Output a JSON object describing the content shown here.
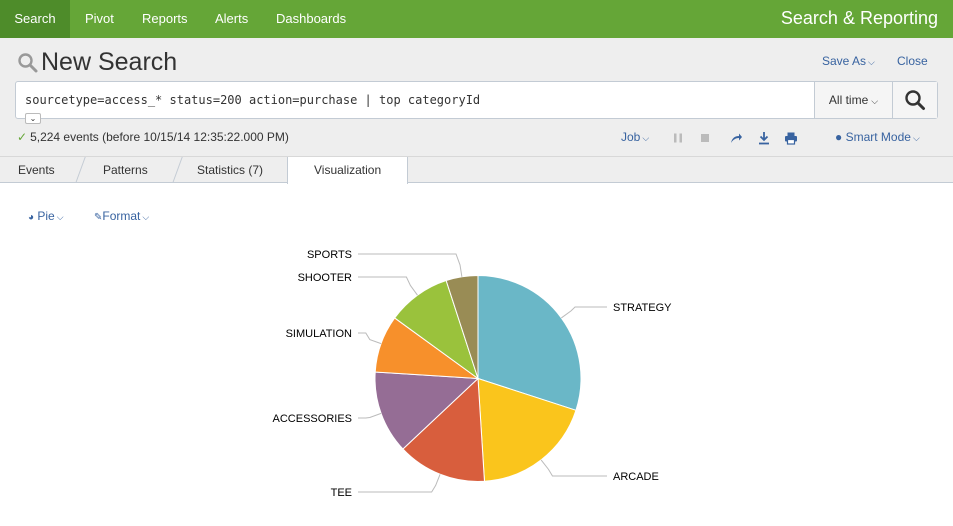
{
  "nav": {
    "items": [
      "Search",
      "Pivot",
      "Reports",
      "Alerts",
      "Dashboards"
    ],
    "active": "Search",
    "app_title": "Search & Reporting"
  },
  "header": {
    "page_title": "New Search",
    "save_as": "Save As",
    "close": "Close",
    "search_query": "sourcetype=access_* status=200 action=purchase | top categoryId",
    "time_range": "All time",
    "event_status": "5,224 events (before 10/15/14 12:35:22.000 PM)",
    "job_label": "Job",
    "mode_label": "Smart Mode"
  },
  "tabs": [
    "Events",
    "Patterns",
    "Statistics (7)",
    "Visualization"
  ],
  "active_tab": "Visualization",
  "viz_controls": {
    "chart_type_label": "Pie",
    "format_label": "Format"
  },
  "colors": {
    "nav_green": "#65a637",
    "link_blue": "#3863a0"
  },
  "chart_data": {
    "type": "pie",
    "title": "",
    "slices": [
      {
        "label": "STRATEGY",
        "value": 30,
        "color": "#6ab7c7"
      },
      {
        "label": "ARCADE",
        "value": 19,
        "color": "#fac51c"
      },
      {
        "label": "TEE",
        "value": 14,
        "color": "#d85e3d"
      },
      {
        "label": "ACCESSORIES",
        "value": 13,
        "color": "#956d95"
      },
      {
        "label": "SIMULATION",
        "value": 9,
        "color": "#f7902b"
      },
      {
        "label": "SHOOTER",
        "value": 10,
        "color": "#9ac23c"
      },
      {
        "label": "SPORTS",
        "value": 5,
        "color": "#998c55"
      }
    ]
  }
}
